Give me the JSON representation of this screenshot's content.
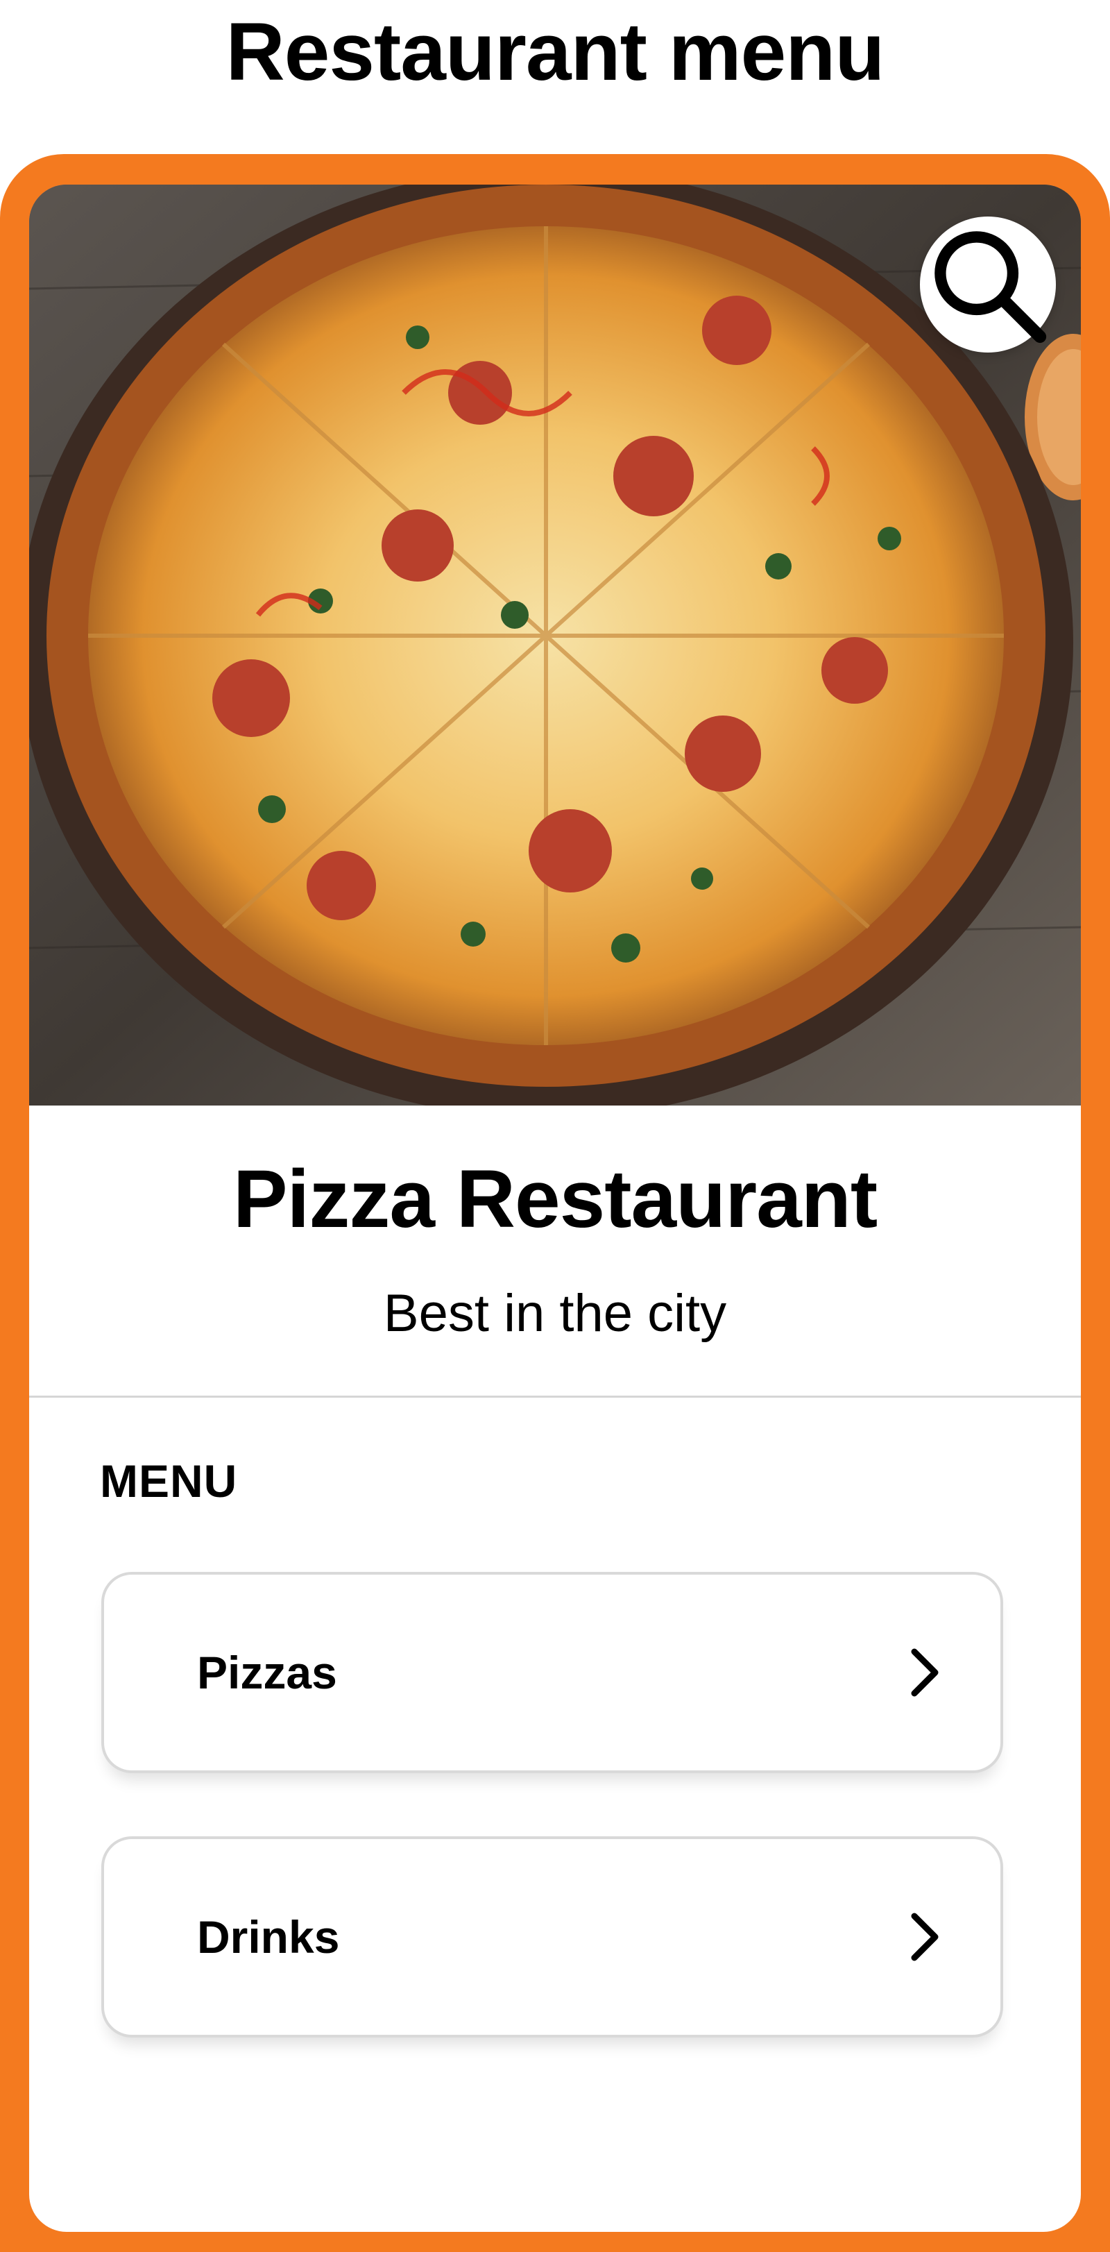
{
  "page": {
    "title": "Restaurant menu"
  },
  "colors": {
    "accent": "#f47a1f",
    "card_border": "#d9d9d9",
    "text": "#000000",
    "background": "#ffffff"
  },
  "hero": {
    "image_description_icon": "pizza-photo",
    "search_icon": "search-icon"
  },
  "restaurant": {
    "name": "Pizza Restaurant",
    "tagline": "Best in the city"
  },
  "menu": {
    "heading": "MENU",
    "items": [
      {
        "label": "Pizzas",
        "icon": "chevron-right-icon"
      },
      {
        "label": "Drinks",
        "icon": "chevron-right-icon"
      }
    ]
  }
}
